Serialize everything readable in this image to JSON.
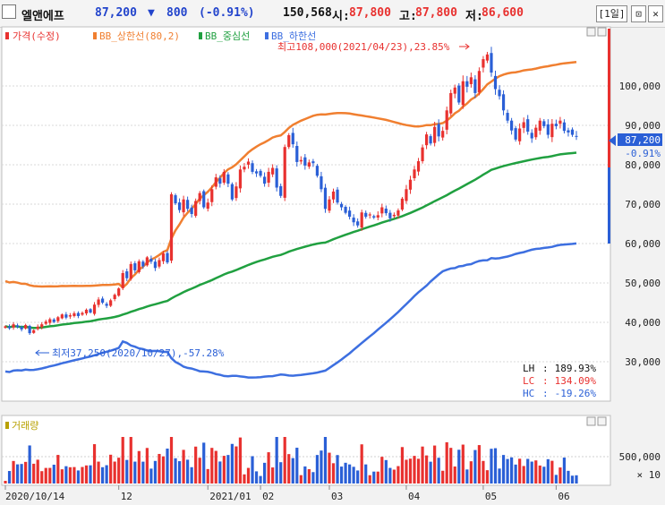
{
  "header": {
    "name": "엘앤에프",
    "price": "87,200",
    "change_arrow": "▼",
    "change": "800",
    "change_pct": "(-0.91%)",
    "volume": "150,568",
    "open_label": "시:",
    "open": "87,800",
    "high_label": "고:",
    "high": "87,800",
    "low_label": "저:",
    "low": "86,600",
    "period": "[1일]"
  },
  "colors": {
    "up": "#e8312f",
    "down": "#2a5fd6",
    "bb_upper": "#f07f30",
    "bb_center": "#20a040",
    "bb_lower": "#3d6fe0"
  },
  "chart_data": [
    {
      "type": "line",
      "legend": [
        {
          "label": "가격(수정)",
          "color": "#e8312f"
        },
        {
          "label": "BB_상한선(80,2)",
          "color": "#f07f30"
        },
        {
          "label": "BB_중심선",
          "color": "#20a040"
        },
        {
          "label": "BB_하한선",
          "color": "#3d6fe0"
        }
      ],
      "ylim": [
        20000,
        115000
      ],
      "y_ticks": [
        30000,
        40000,
        50000,
        60000,
        70000,
        80000,
        90000,
        100000
      ],
      "y_tick_labels": [
        "30,000",
        "40,000",
        "50,000",
        "60,000",
        "70,000",
        "80,000",
        "90,000",
        "100,000"
      ],
      "x_tick_labels": [
        "2020/10/14",
        "12",
        "2021/01",
        "02",
        "03",
        "04",
        "05",
        "06"
      ],
      "price_close": [
        39000,
        38500,
        39500,
        38800,
        38200,
        39300,
        37250,
        38000,
        38900,
        39500,
        40200,
        40800,
        40100,
        41300,
        42000,
        41200,
        41800,
        42300,
        41600,
        42400,
        43200,
        42500,
        44500,
        45800,
        45000,
        44200,
        45600,
        47000,
        48600,
        52500,
        51200,
        54800,
        53200,
        55500,
        54200,
        56500,
        55400,
        53800,
        55800,
        57500,
        55200,
        72500,
        70200,
        68500,
        71200,
        68800,
        67500,
        70800,
        72800,
        69200,
        70400,
        73800,
        76800,
        75200,
        78200,
        75200,
        71200,
        74500,
        78800,
        79500,
        80800,
        78200,
        77800,
        77200,
        75200,
        78200,
        79200,
        74200,
        72100,
        84500,
        87500,
        85200,
        80700,
        81200,
        79800,
        80600,
        80400,
        77200,
        73800,
        68800,
        71200,
        73200,
        70400,
        69200,
        67800,
        66800,
        65400,
        64600,
        67900,
        66800,
        67400,
        66600,
        67200,
        69200,
        67700,
        66400,
        67300,
        68400,
        71400,
        73800,
        76200,
        78800,
        80900,
        84400,
        87700,
        85400,
        89600,
        87200,
        88600,
        93800,
        98200,
        99600,
        95800,
        101200,
        99800,
        102200,
        98200,
        103800,
        106800,
        108000,
        103400,
        99200,
        97400,
        93800,
        91200,
        88700,
        86400,
        89200,
        90800,
        88400,
        86700,
        89400,
        91200,
        89800,
        87600,
        90400,
        89800,
        91200,
        88600,
        88200,
        87600,
        87200
      ],
      "annotations": [
        "최고108,000(2021/04/23),23.85%",
        "최저37,250(2020/10/27),-57.28%"
      ],
      "last_price_label": "87,200",
      "last_change_label": "-0.91%",
      "stats": [
        {
          "label": "LH",
          "value": "189.93%"
        },
        {
          "label": "LC",
          "value": "134.09%"
        },
        {
          "label": "HC",
          "value": "-19.26%"
        }
      ]
    },
    {
      "type": "bar",
      "legend": [
        {
          "label": "거래량",
          "color": "#b8a000"
        }
      ],
      "y_tick_labels": [
        "500,000"
      ],
      "unit_label": "× 10"
    }
  ]
}
